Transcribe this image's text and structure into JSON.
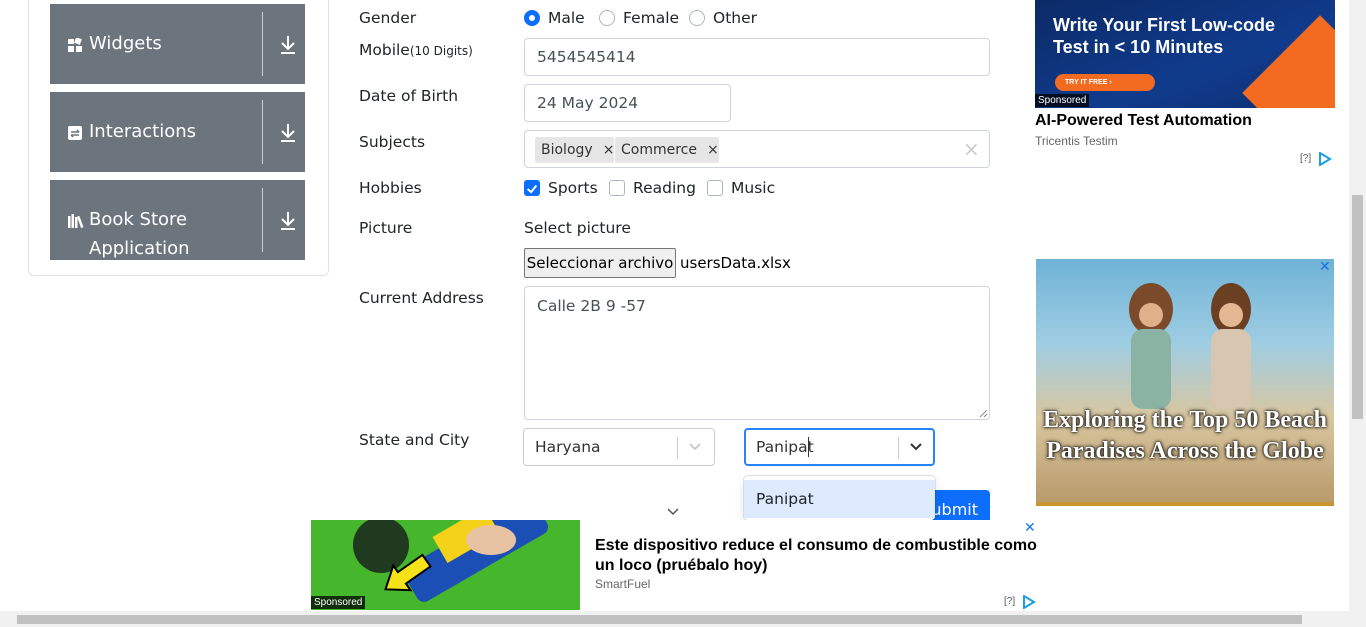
{
  "sidebar": {
    "groups": [
      {
        "label": "Widgets",
        "icon": "widgets-icon"
      },
      {
        "label": "Interactions",
        "icon": "interactions-icon"
      },
      {
        "label_line1": "Book Store",
        "label_line2": "Application",
        "icon": "book-store-icon"
      }
    ]
  },
  "form": {
    "gender": {
      "label": "Gender",
      "options": [
        "Male",
        "Female",
        "Other"
      ],
      "selected": "Male"
    },
    "mobile": {
      "label": "Mobile",
      "hint": "(10 Digits)",
      "value": "5454545414"
    },
    "dob": {
      "label": "Date of Birth",
      "value": "24 May 2024"
    },
    "subjects": {
      "label": "Subjects",
      "chips": [
        "Biology",
        "Commerce"
      ],
      "clear_glyph": "×",
      "chip_remove_glyph": "×"
    },
    "hobbies": {
      "label": "Hobbies",
      "options": [
        "Sports",
        "Reading",
        "Music"
      ],
      "checked": [
        "Sports"
      ]
    },
    "picture": {
      "label": "Picture",
      "prompt": "Select picture",
      "button_label": "Seleccionar archivo",
      "file_name": "usersData.xlsx"
    },
    "address": {
      "label": "Current Address",
      "value": "Calle 2B 9 -57"
    },
    "state_city": {
      "label": "State and City",
      "state_value": "Haryana",
      "city_value": "Panipat",
      "dropdown_option": "Panipat"
    },
    "submit_label": "Submit"
  },
  "ads": {
    "top": {
      "headline": "Write Your First Low-code Test in < 10 Minutes",
      "cta": "TRY IT FREE  ›",
      "sponsored": "Sponsored",
      "title": "AI-Powered Test Automation",
      "source": "Tricentis Testim",
      "adchoice": "[?]"
    },
    "beach": {
      "headline": "Exploring the Top 50 Beach Paradises Across the Globe",
      "close": "✕"
    },
    "bottom": {
      "title": "Este dispositivo reduce el consumo de combustible como un loco (pruébalo hoy)",
      "source": "SmartFuel",
      "sponsored": "Sponsored",
      "adchoice": "[?]",
      "close": "✕"
    }
  },
  "colors": {
    "accent": "#0d6efd",
    "sidebar_group": "#6c757d",
    "option_highlight": "#deebff",
    "ad_orange": "#f26b21"
  }
}
